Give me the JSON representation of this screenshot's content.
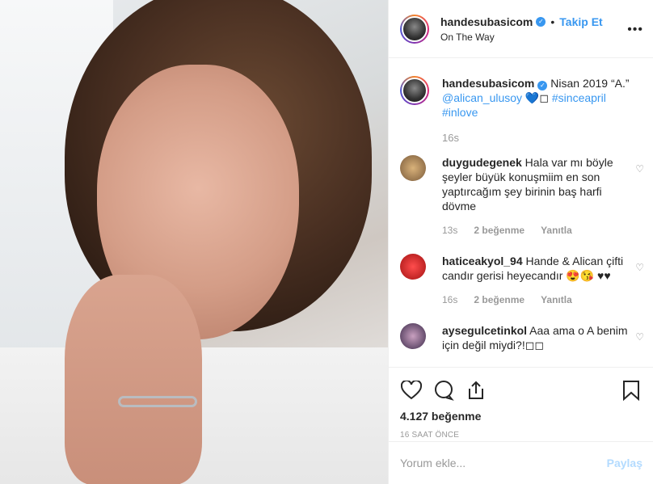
{
  "header": {
    "username": "handesubasicom",
    "follow_label": "Takip Et",
    "dot": "•",
    "location": "On The Way",
    "more": "•••"
  },
  "caption": {
    "username": "handesubasicom",
    "text": " Nisan 2019 “A.”",
    "mention": "@alican_ulusoy",
    "emoji": " 💙◻ ",
    "tags": "#sinceapril #inlove",
    "time": "16s"
  },
  "comments": [
    {
      "username": "duygudegenek",
      "text": " Hala var mı böyle şeyler büyük konuşmiim en son yaptırcağım şey birinin baş harfi dövme",
      "time": "13s",
      "likes": "2 beğenme",
      "reply": "Yanıtla"
    },
    {
      "username": "haticeakyol_94",
      "text": " Hande & Alican çifti candır gerisi heyecandır 😍😘 ♥♥",
      "time": "16s",
      "likes": "2 beğenme",
      "reply": "Yanıtla"
    },
    {
      "username": "aysegulcetinkol",
      "text": " Aaa ama o A benim için değil miydi?!◻◻",
      "time": "",
      "likes": "",
      "reply": ""
    }
  ],
  "actions": {
    "likes": "4.127 beğenme",
    "time": "16 SAAT ÖNCE"
  },
  "add_comment": {
    "placeholder": "Yorum ekle...",
    "post_label": "Paylaş"
  },
  "colors": {
    "accent": "#3897f0",
    "link": "#003569",
    "muted": "#999999"
  }
}
